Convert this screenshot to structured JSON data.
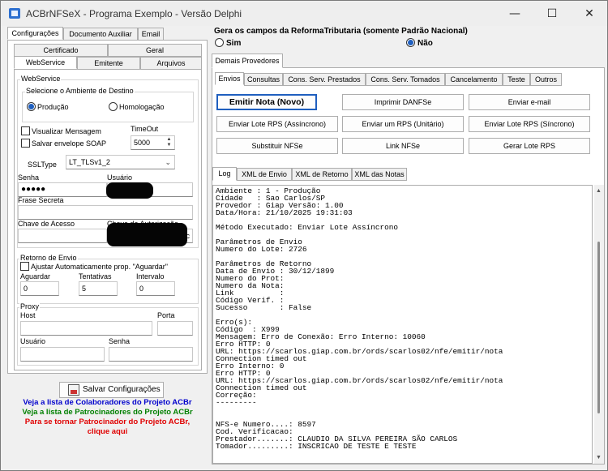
{
  "window": {
    "title": "ACBrNFSeX - Programa Exemplo - Versão Delphi",
    "min_glyph": "—",
    "max_glyph": "☐",
    "close_glyph": "✕"
  },
  "left": {
    "top_tabs": [
      "Configurações",
      "Documento Auxiliar",
      "Email"
    ],
    "sub_tabs_row1": [
      "Certificado",
      "Geral"
    ],
    "sub_tabs_row2": [
      "WebService",
      "Emitente",
      "Arquivos"
    ],
    "webservice": {
      "group_label": "WebService",
      "env_group_label": "Selecione o Ambiente de Destino",
      "env_options": [
        "Produção",
        "Homologação"
      ],
      "visualizar_label": "Visualizar Mensagem",
      "salvar_label": "Salvar envelope SOAP",
      "timeout_label": "TimeOut",
      "timeout_value": "5000",
      "ssltype_label": "SSLType",
      "ssltype_value": "LT_TLSv1_2",
      "senha_label": "Senha",
      "senha_value": "●●●●●",
      "usuario_label": "Usuário",
      "frase_label": "Frase Secreta",
      "chave_acesso_label": "Chave de Acesso",
      "chave_autorizacao_label": "Chave de Autorização",
      "chave_autorizacao_tail": "c"
    },
    "retorno": {
      "group_label": "Retorno de Envio",
      "ajustar_label": "Ajustar Automaticamente prop. \"Aguardar\"",
      "aguardar_label": "Aguardar",
      "aguardar_value": "0",
      "tentativas_label": "Tentativas",
      "tentativas_value": "5",
      "intervalo_label": "Intervalo",
      "intervalo_value": "0"
    },
    "proxy": {
      "group_label": "Proxy",
      "host_label": "Host",
      "porta_label": "Porta",
      "usuario_label": "Usuário",
      "senha_label": "Senha"
    },
    "save_button": "Salvar Configurações",
    "links": {
      "colaboradores": "Veja a lista de Colaboradores do Projeto ACBr",
      "patrocinadores": "Veja a lista de Patrocinadores do Projeto ACBr",
      "tornar_line1": "Para se tornar Patrocinador do Projeto ACBr,",
      "tornar_line2": "clique aqui"
    },
    "colors": {
      "colaboradores": "#0000cc",
      "patrocinadores": "#008000",
      "tornar": "#e00000"
    }
  },
  "right": {
    "reforma_label": "Gera os campos da ReformaTributaria (somente Padrão Nacional)",
    "reforma_options": [
      "Sim",
      "Não"
    ],
    "provider_tab": "Demais Provedores",
    "action_tabs": [
      "Envios",
      "Consultas",
      "Cons. Serv. Prestados",
      "Cons. Serv. Tomados",
      "Cancelamento",
      "Teste",
      "Outros"
    ],
    "buttons": [
      [
        "Emitir Nota (Novo)",
        "Imprimir DANFSe",
        "Enviar e-mail"
      ],
      [
        "Enviar Lote RPS (Assíncrono)",
        "Enviar um RPS (Unitário)",
        "Enviar Lote RPS (Síncrono)"
      ],
      [
        "Substituir NFSe",
        "Link NFSe",
        "Gerar Lote RPS"
      ]
    ],
    "log_tabs": [
      "Log",
      "XML de Envio",
      "XML de Retorno",
      "XML das Notas"
    ],
    "log_lines": [
      "Ambiente : 1 - Produção",
      "Cidade   : Sao Carlos/SP",
      "Provedor : Giap Versão: 1.00",
      "Data/Hora: 21/10/2025 19:31:03",
      "",
      "Método Executado: Enviar Lote Assíncrono",
      "",
      "Parâmetros de Envio",
      "Numero do Lote: 2726",
      "",
      "Parâmetros de Retorno",
      "Data de Envio : 30/12/1899",
      "Numero do Prot:",
      "Numero da Nota:",
      "Link          :",
      "Código Verif. :",
      "Sucesso       : False",
      "",
      "Erro(s):",
      "Código  : X999",
      "Mensagem: Erro de Conexão: Erro Interno: 10060",
      "Erro HTTP: 0",
      "URL: https://scarlos.giap.com.br/ords/scarlos02/nfe/emitir/nota",
      "Connection timed out",
      "Erro Interno: 0",
      "Erro HTTP: 0",
      "URL: https://scarlos.giap.com.br/ords/scarlos02/nfe/emitir/nota",
      "Connection timed out",
      "Correção:",
      "---------",
      "",
      "NFS-e Numero....: 8597",
      "Cod. Verificacao:",
      "Prestador.......: CLAUDIO DA SILVA PEREIRA SÃO CARLOS",
      "Tomador.........: INSCRICAO DE TESTE E TESTE"
    ]
  }
}
